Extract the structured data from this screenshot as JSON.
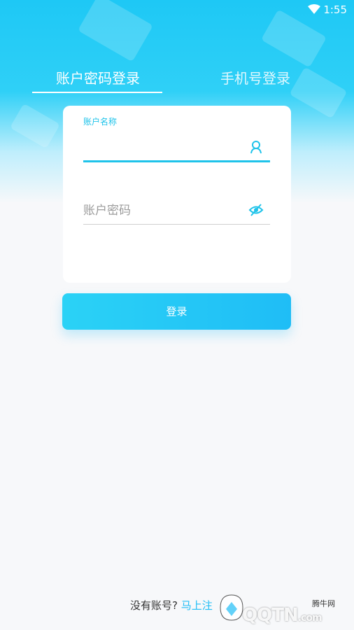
{
  "status_bar": {
    "time": "1:55"
  },
  "tabs": {
    "account_login": "账户密码登录",
    "phone_login": "手机号登录"
  },
  "form": {
    "username_label": "账户名称",
    "username_value": "",
    "password_placeholder": "账户密码"
  },
  "login_button": "登录",
  "footer": {
    "no_account": "没有账号?",
    "register": "马上注"
  },
  "watermark": {
    "brand": "QQTN",
    "suffix": ".com",
    "site": "腾牛网"
  },
  "colors": {
    "accent": "#1fc3ea",
    "button": "#1fbdf6"
  },
  "icons": [
    "wifi-icon",
    "user-icon",
    "eye-off-icon"
  ]
}
